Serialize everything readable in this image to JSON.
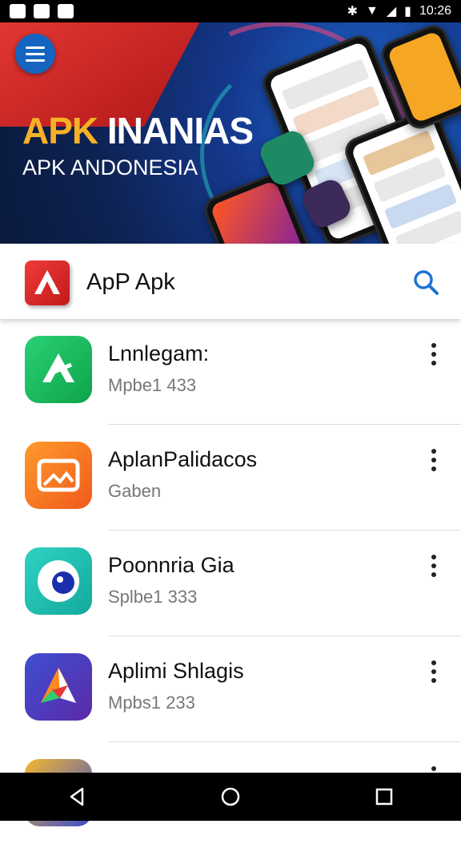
{
  "status_bar": {
    "time": "10:26"
  },
  "banner": {
    "title_accent": "APK",
    "title_rest": " INANIAS",
    "subtitle": "APK ANDONESIA"
  },
  "app_bar": {
    "title": "ApP Apk"
  },
  "apps": [
    {
      "name": "Lnnlegam:",
      "sub": "Mpbe1 433",
      "icon": "green-arrow-icon"
    },
    {
      "name": "AplanPalidacos",
      "sub": "Gaben",
      "icon": "orange-image-icon"
    },
    {
      "name": "Poonnria Gia",
      "sub": "Splbe1 333",
      "icon": "teal-eye-icon"
    },
    {
      "name": "Aplimi Shlagis",
      "sub": "Mpbs1 233",
      "icon": "blue-play-icon"
    }
  ],
  "colors": {
    "brand_blue": "#1565c0",
    "accent_orange": "#f7b126",
    "logo_red": "#e53935"
  }
}
